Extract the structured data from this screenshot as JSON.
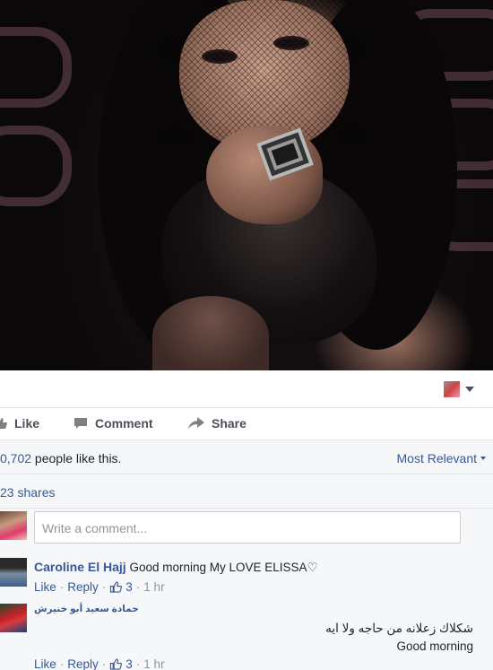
{
  "post": {
    "photo_alt": "Photo",
    "reaction_icon": "avatar-thumb-icon"
  },
  "actions": {
    "like_label": "Like",
    "comment_label": "Comment",
    "share_label": "Share"
  },
  "stats": {
    "likes_count": "0,702",
    "likes_suffix": " people like this.",
    "people_word": "people",
    "sort_label": "Most Relevant",
    "shares_text": "23 shares"
  },
  "composer": {
    "placeholder": "Write a comment..."
  },
  "comments": [
    {
      "author": "Caroline El Hajj",
      "text": "Good morning My LOVE ELISSA♡",
      "like_label": "Like",
      "reply_label": "Reply",
      "reactions": "3",
      "time": "1 hr"
    },
    {
      "author": "حمادة سعيد أبو خنيرش",
      "text_line1": "شكلاك زعلانه من حاجه ولا ايه",
      "text_line2": "Good morning",
      "like_label": "Like",
      "reply_label": "Reply",
      "reactions": "3",
      "time": "1 hr"
    }
  ],
  "colors": {
    "link": "#365899",
    "meta": "#90949c",
    "action": "#4b4f56",
    "stats_bg": "#f6f7f9"
  }
}
